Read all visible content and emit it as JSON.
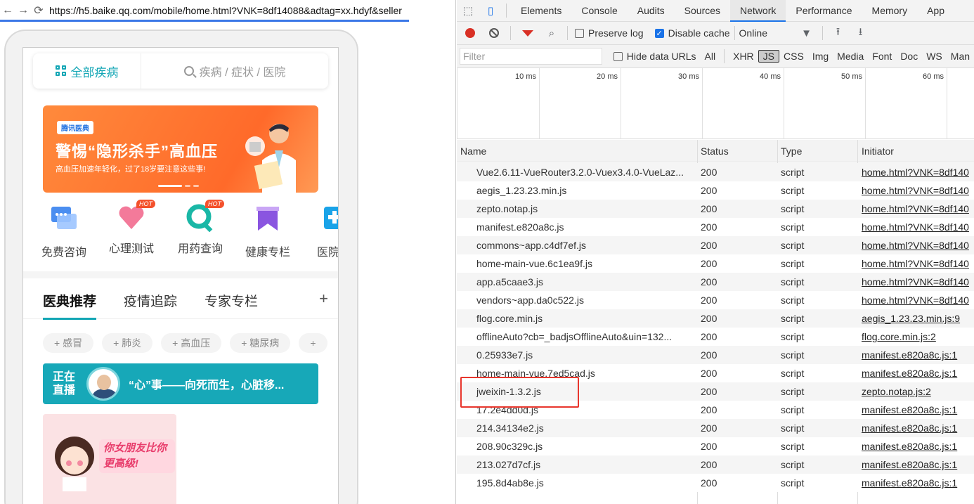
{
  "browser": {
    "url": "https://h5.baike.qq.com/mobile/home.html?VNK=8df14088&adtag=xx.hdyf&seller"
  },
  "app": {
    "all_diseases": "全部疾病",
    "search_placeholder": "疾病 / 症状 / 医院",
    "banner": {
      "logo": "腾讯医典",
      "title": "警惕“隐形杀手”高血压",
      "subtitle": "高血压加速年轻化，过了18岁要注意这些事!"
    },
    "icons": [
      {
        "label": "免费咨询",
        "icon": "chat-bubble-icon",
        "hot": ""
      },
      {
        "label": "心理测试",
        "icon": "heart-icon",
        "hot": "HOT"
      },
      {
        "label": "用药查询",
        "icon": "pill-search-icon",
        "hot": "HOT"
      },
      {
        "label": "健康专栏",
        "icon": "bookmark-icon",
        "hot": ""
      },
      {
        "label": "医院挂",
        "icon": "hospital-icon",
        "hot": ""
      }
    ],
    "tabs": [
      "医典推荐",
      "疫情追踪",
      "专家专栏"
    ],
    "tab_plus": "+",
    "chips": [
      "+ 感冒",
      "+ 肺炎",
      "+ 高血压",
      "+ 糖尿病",
      "+"
    ],
    "live": {
      "badge_line1": "正在",
      "badge_line2": "直播",
      "text": "“心”事——向死而生，心脏移..."
    },
    "card": {
      "bubble": "你女朋友比你更高级!"
    }
  },
  "devtools": {
    "tabs": [
      "Elements",
      "Console",
      "Audits",
      "Sources",
      "Network",
      "Performance",
      "Memory",
      "App"
    ],
    "active_tab": "Network",
    "toolbar": {
      "preserve_log": "Preserve log",
      "disable_cache": "Disable cache",
      "throttle": "Online"
    },
    "filter": {
      "placeholder": "Filter",
      "hide_data_urls": "Hide data URLs",
      "types": [
        "All",
        "XHR",
        "JS",
        "CSS",
        "Img",
        "Media",
        "Font",
        "Doc",
        "WS",
        "Man"
      ],
      "active": "JS"
    },
    "timeline_ticks": [
      "10 ms",
      "20 ms",
      "30 ms",
      "40 ms",
      "50 ms",
      "60 ms"
    ],
    "columns": [
      "Name",
      "Status",
      "Type",
      "Initiator"
    ],
    "rows": [
      {
        "name": "Vue2.6.11-VueRouter3.2.0-Vuex3.4.0-VueLaz...",
        "status": "200",
        "type": "script",
        "initiator": "home.html?VNK=8df140"
      },
      {
        "name": "aegis_1.23.23.min.js",
        "status": "200",
        "type": "script",
        "initiator": "home.html?VNK=8df140"
      },
      {
        "name": "zepto.notap.js",
        "status": "200",
        "type": "script",
        "initiator": "home.html?VNK=8df140"
      },
      {
        "name": "manifest.e820a8c.js",
        "status": "200",
        "type": "script",
        "initiator": "home.html?VNK=8df140"
      },
      {
        "name": "commons~app.c4df7ef.js",
        "status": "200",
        "type": "script",
        "initiator": "home.html?VNK=8df140"
      },
      {
        "name": "home-main-vue.6c1ea9f.js",
        "status": "200",
        "type": "script",
        "initiator": "home.html?VNK=8df140"
      },
      {
        "name": "app.a5caae3.js",
        "status": "200",
        "type": "script",
        "initiator": "home.html?VNK=8df140"
      },
      {
        "name": "vendors~app.da0c522.js",
        "status": "200",
        "type": "script",
        "initiator": "home.html?VNK=8df140"
      },
      {
        "name": "flog.core.min.js",
        "status": "200",
        "type": "script",
        "initiator": "aegis_1.23.23.min.js:9"
      },
      {
        "name": "offlineAuto?cb=_badjsOfflineAuto&uin=132...",
        "status": "200",
        "type": "script",
        "initiator": "flog.core.min.js:2"
      },
      {
        "name": "0.25933e7.js",
        "status": "200",
        "type": "script",
        "initiator": "manifest.e820a8c.js:1"
      },
      {
        "name": "home-main-vue.7ed5cad.js",
        "status": "200",
        "type": "script",
        "initiator": "manifest.e820a8c.js:1"
      },
      {
        "name": "jweixin-1.3.2.js",
        "status": "200",
        "type": "script",
        "initiator": "zepto.notap.js:2"
      },
      {
        "name": "17.2e4dd0d.js",
        "status": "200",
        "type": "script",
        "initiator": "manifest.e820a8c.js:1"
      },
      {
        "name": "214.34134e2.js",
        "status": "200",
        "type": "script",
        "initiator": "manifest.e820a8c.js:1"
      },
      {
        "name": "208.90c329c.js",
        "status": "200",
        "type": "script",
        "initiator": "manifest.e820a8c.js:1"
      },
      {
        "name": "213.027d7cf.js",
        "status": "200",
        "type": "script",
        "initiator": "manifest.e820a8c.js:1"
      },
      {
        "name": "195.8d4ab8e.js",
        "status": "200",
        "type": "script",
        "initiator": "manifest.e820a8c.js:1"
      }
    ],
    "highlight_color": "#e8362d",
    "accent": "#1a73e8"
  }
}
